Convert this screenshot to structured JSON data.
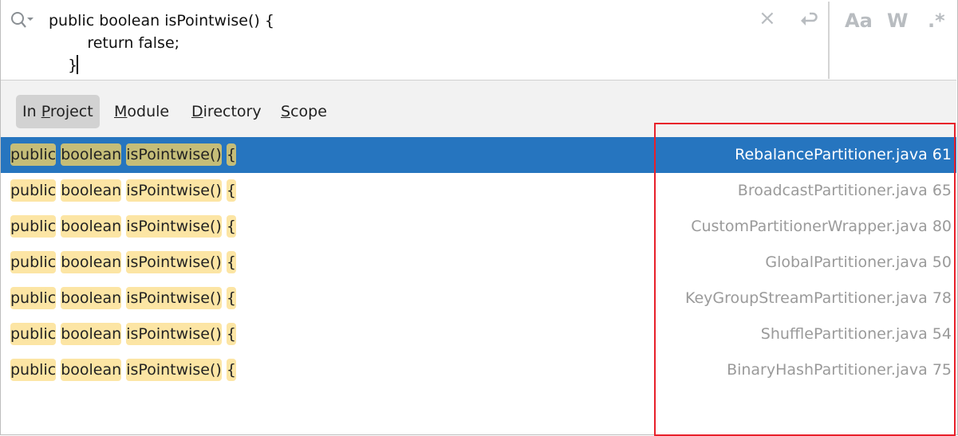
{
  "search": {
    "query_lines": [
      "public boolean isPointwise() {",
      "        return false;",
      "    }"
    ],
    "icons": {
      "search": "search-history-icon",
      "clear": "close-icon",
      "newline": "newline-icon",
      "match_case": "Aa",
      "words": "W",
      "regex": ".*"
    }
  },
  "scopes": [
    {
      "pre": "In ",
      "key": "P",
      "post": "roject",
      "active": true
    },
    {
      "pre": "",
      "key": "M",
      "post": "odule",
      "active": false
    },
    {
      "pre": "",
      "key": "D",
      "post": "irectory",
      "active": false
    },
    {
      "pre": "",
      "key": "S",
      "post": "cope",
      "active": false
    }
  ],
  "results": [
    {
      "code": [
        "public",
        "boolean",
        "isPointwise()",
        "{"
      ],
      "file": "RebalancePartitioner.java 61",
      "selected": true
    },
    {
      "code": [
        "public",
        "boolean",
        "isPointwise()",
        "{"
      ],
      "file": "BroadcastPartitioner.java 65"
    },
    {
      "code": [
        "public",
        "boolean",
        "isPointwise()",
        "{"
      ],
      "file": "CustomPartitionerWrapper.java 80"
    },
    {
      "code": [
        "public",
        "boolean",
        "isPointwise()",
        "{"
      ],
      "file": "GlobalPartitioner.java 50"
    },
    {
      "code": [
        "public",
        "boolean",
        "isPointwise()",
        "{"
      ],
      "file": "KeyGroupStreamPartitioner.java 78"
    },
    {
      "code": [
        "public",
        "boolean",
        "isPointwise()",
        "{"
      ],
      "file": "ShufflePartitioner.java 54"
    },
    {
      "code": [
        "public",
        "boolean",
        "isPointwise()",
        "{"
      ],
      "file": "BinaryHashPartitioner.java 75"
    }
  ],
  "colors": {
    "selection": "#2675bf",
    "match_highlight": "#fce5a4",
    "annotation": "#e8202a"
  }
}
